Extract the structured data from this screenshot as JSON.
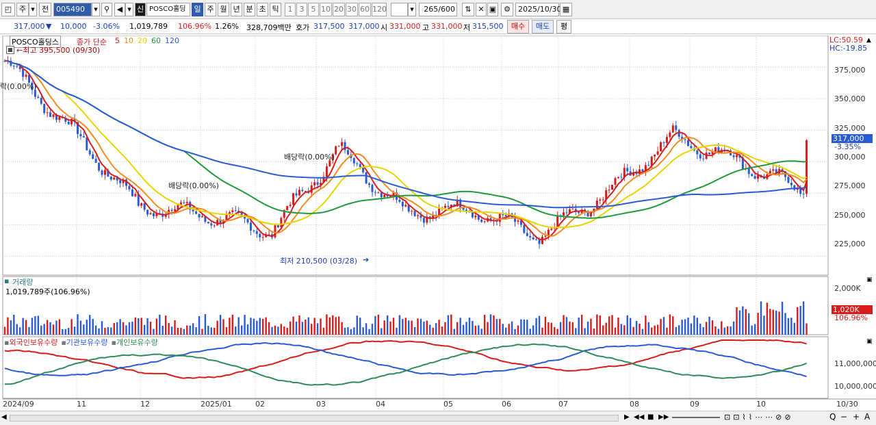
{
  "toolbar": {
    "period_unit": "주",
    "type_label": "전",
    "stock_code": "005490",
    "sin_label": "신",
    "stock_name": "POSCO홀딩스",
    "periods": [
      "일",
      "주",
      "월",
      "년",
      "분",
      "초",
      "틱"
    ],
    "active_period": "일",
    "intervals": [
      "1",
      "3",
      "5",
      "10",
      "20",
      "30",
      "60",
      "120"
    ],
    "count": "265",
    "count_total": "/600",
    "date": "2025/10/30"
  },
  "quote": {
    "price": "317,000",
    "change": "10,000",
    "change_pct": "-3.06%",
    "volume": "1,019,789",
    "vol_ratio": "106.96%",
    "turnover": "1.26%",
    "amount": "328,709백만",
    "bid_label": "호가",
    "bid1": "317,500",
    "bid2": "317,000",
    "open_label": "시",
    "open": "331,000",
    "high_label": "고",
    "high": "331,000",
    "low_label": "저",
    "low": "315,500",
    "buy_label": "매수",
    "sell_label": "매도",
    "eval_label": "평"
  },
  "price_panel": {
    "name_tag": "POSCO홀딩스",
    "ma_label": "종가 단순",
    "ma_periods": [
      {
        "label": "5",
        "color": "#d71c1c"
      },
      {
        "label": "10",
        "color": "#f28c1e"
      },
      {
        "label": "20",
        "color": "#e8d400"
      },
      {
        "label": "60",
        "color": "#1f9a3a"
      },
      {
        "label": "120",
        "color": "#2a5bd7"
      }
    ],
    "max_label": "←최고 395,500 (09/30)",
    "min_label": "최저 210,500 (03/28)",
    "dividend1": "락(0.00%)",
    "dividend2": "배당락(0.00%)",
    "dividend3": "배당락(0.00%)",
    "lc": "LC:50.59",
    "hc": "HC:-19.85",
    "y_ticks": [
      "375,000",
      "350,000",
      "325,000",
      "300,000",
      "275,000",
      "250,000",
      "225,000"
    ],
    "cur_price": "317,000",
    "cur_pct": "-3.35%"
  },
  "volume_panel": {
    "title": "거래량",
    "value": "1,019,789주(106.96%)",
    "y_tick": "2,000K",
    "cur_value": "1,020K",
    "cur_pct": "106.96%"
  },
  "holdings_panel": {
    "legend": [
      {
        "label": "외국인보유수량",
        "color": "#d71c1c"
      },
      {
        "label": "기관보유수량",
        "color": "#2a5bd7"
      },
      {
        "label": "개인보유수량",
        "color": "#2e8b57"
      }
    ],
    "y_ticks": [
      "11,000,000",
      "10,000,000"
    ]
  },
  "x_axis": [
    "2024/09",
    "11",
    "12",
    "2025/01",
    "02",
    "03",
    "04",
    "05",
    "06",
    "07",
    "08",
    "09",
    "10",
    "10/30"
  ],
  "colors": {
    "up": "#d71c1c",
    "down": "#2a5bd7",
    "bg": "#ffffff",
    "grid": "#c8c8c8"
  },
  "chart_data": {
    "type": "candlestick",
    "title": "POSCO홀딩스",
    "ylim": [
      210000,
      400000
    ],
    "x": [
      "2024/09",
      "11",
      "12",
      "2025/01",
      "02",
      "03",
      "04",
      "05",
      "06",
      "07",
      "08",
      "09",
      "10"
    ],
    "close_approx": [
      380000,
      325000,
      265000,
      258000,
      245000,
      310000,
      260000,
      262000,
      240000,
      275000,
      320000,
      300000,
      275000
    ],
    "annotations": {
      "max": {
        "value": 395500,
        "date": "09/30"
      },
      "min": {
        "value": 210500,
        "date": "03/28"
      }
    },
    "last_close": 317000
  }
}
